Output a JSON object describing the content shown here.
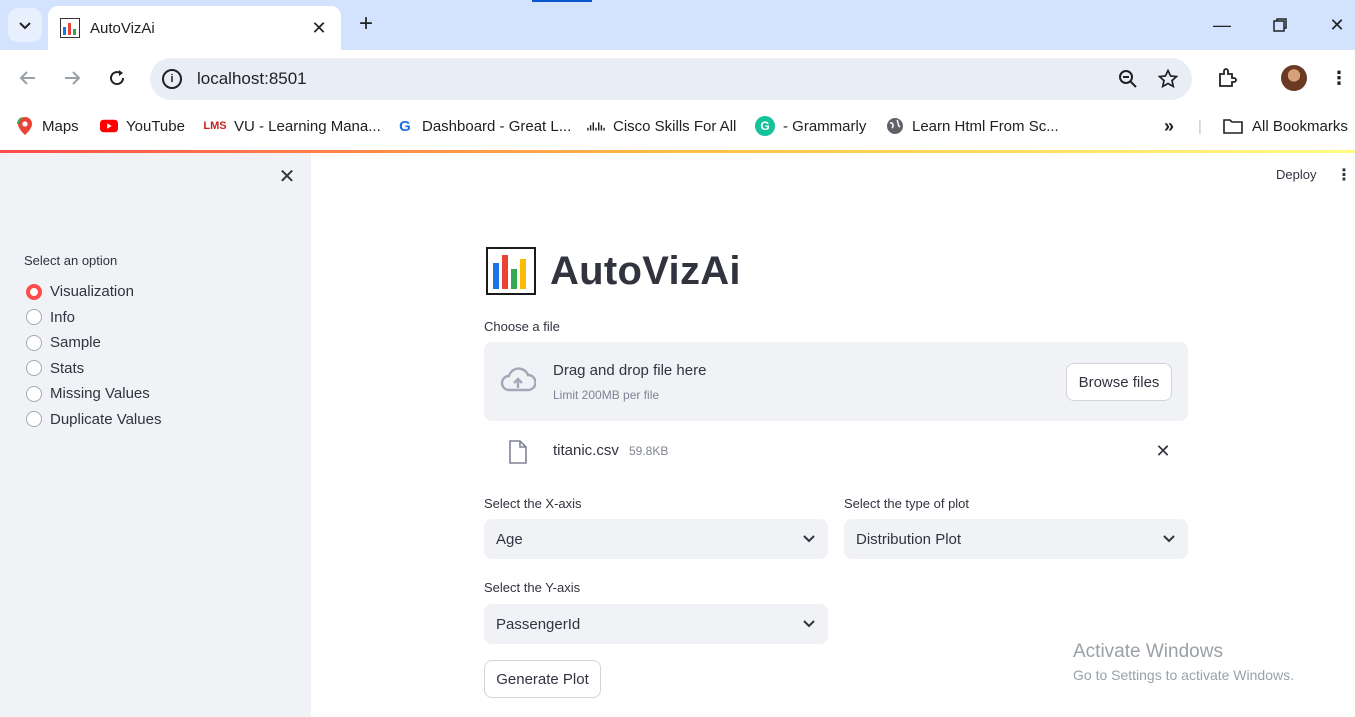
{
  "browser": {
    "tab_title": "AutoVizAi",
    "url": "localhost:8501",
    "bookmarks": [
      {
        "label": "Maps",
        "icon": "maps-icon"
      },
      {
        "label": "YouTube",
        "icon": "youtube-icon"
      },
      {
        "label": "VU - Learning Mana...",
        "icon": "lms-icon"
      },
      {
        "label": "Dashboard - Great L...",
        "icon": "great-learning-icon"
      },
      {
        "label": "Cisco Skills For All",
        "icon": "cisco-icon"
      },
      {
        "label": "- Grammarly",
        "icon": "grammarly-icon"
      },
      {
        "label": "Learn Html From Sc...",
        "icon": "globe-icon"
      }
    ],
    "all_bookmarks": "All Bookmarks"
  },
  "sidebar": {
    "label": "Select an option",
    "options": [
      "Visualization",
      "Info",
      "Sample",
      "Stats",
      "Missing Values",
      "Duplicate Values"
    ],
    "selected": "Visualization"
  },
  "header": {
    "deploy_label": "Deploy"
  },
  "main": {
    "title": "AutoVizAi",
    "file_label": "Choose a file",
    "dropzone_main": "Drag and drop file here",
    "dropzone_sub": "Limit 200MB per file",
    "browse_label": "Browse files",
    "file_name": "titanic.csv",
    "file_size": "59.8KB",
    "x_axis_label": "Select the X-axis",
    "x_axis_value": "Age",
    "plot_type_label": "Select the type of plot",
    "plot_type_value": "Distribution Plot",
    "y_axis_label": "Select the Y-axis",
    "y_axis_value": "PassengerId",
    "generate_label": "Generate Plot"
  },
  "watermark": {
    "line1": "Activate Windows",
    "line2": "Go to Settings to activate Windows."
  },
  "colors": {
    "accent": "#ff4b4b",
    "sidebar_bg": "#f0f2f6",
    "tabstrip_bg": "#d3e3fd"
  }
}
